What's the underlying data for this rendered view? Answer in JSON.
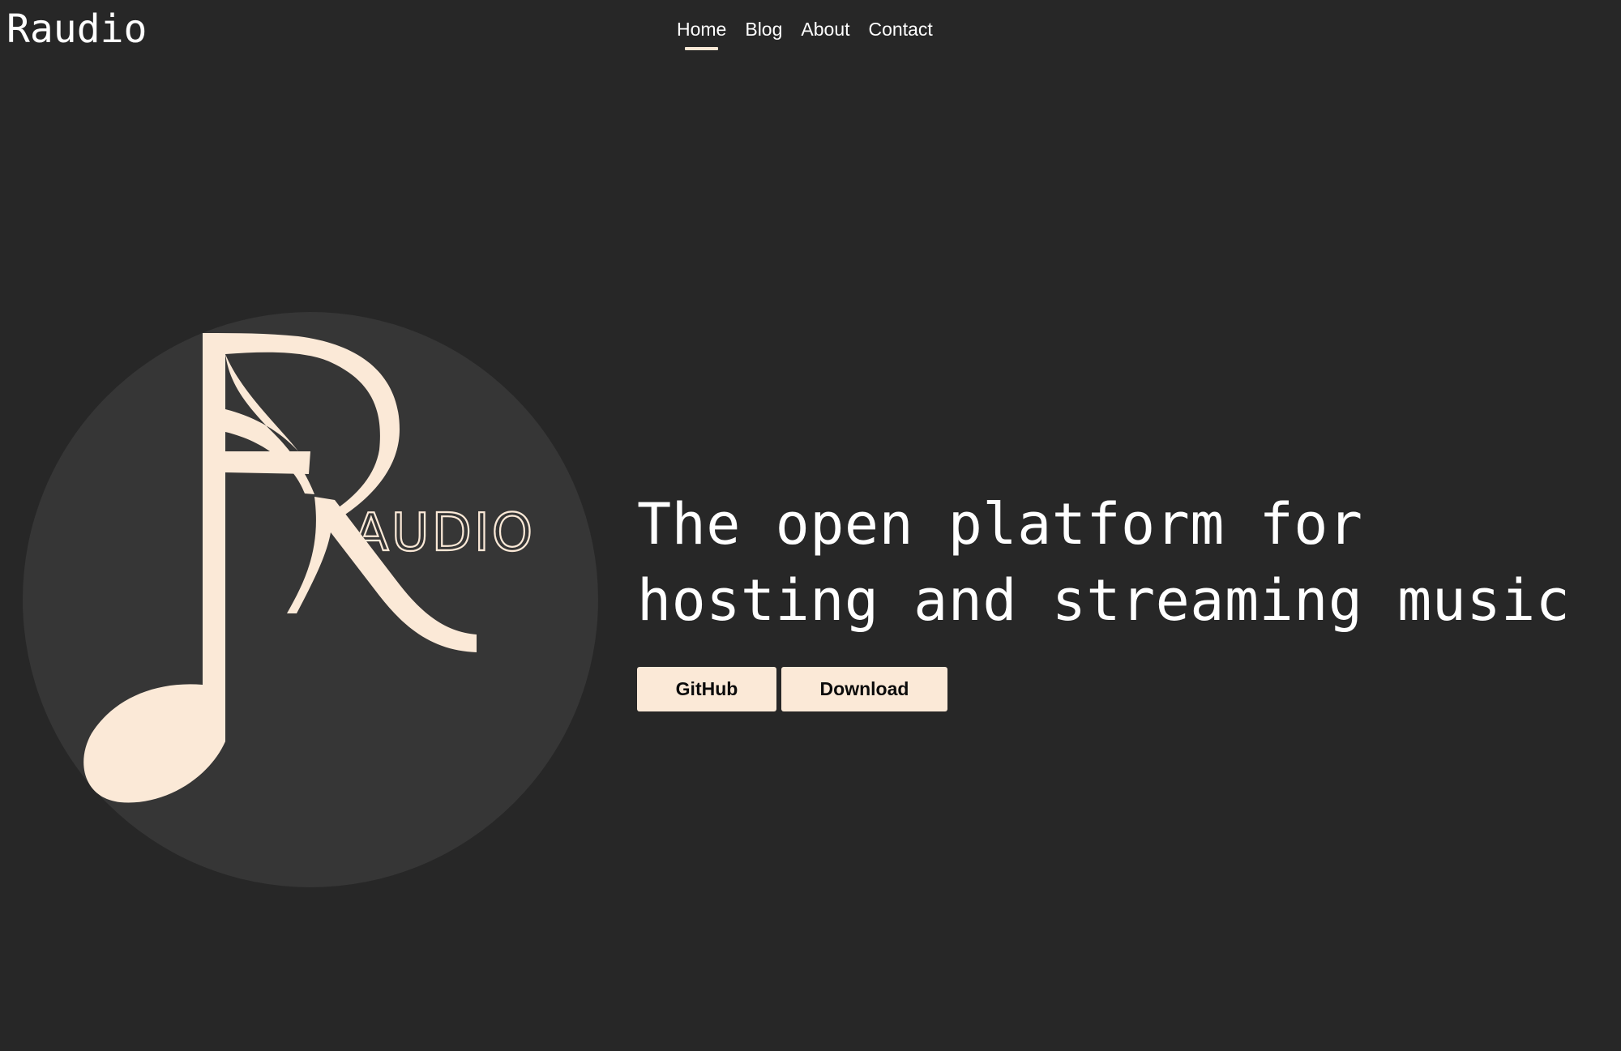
{
  "header": {
    "brand": "Raudio",
    "nav": [
      {
        "label": "Home",
        "active": true
      },
      {
        "label": "Blog",
        "active": false
      },
      {
        "label": "About",
        "active": false
      },
      {
        "label": "Contact",
        "active": false
      }
    ]
  },
  "hero": {
    "logo": {
      "icon": "music-note-r-logo-icon",
      "wordmark": "AUDIO"
    },
    "headline_lines": [
      "The open platform for",
      "hosting and streaming music"
    ],
    "buttons": [
      {
        "label": "GitHub"
      },
      {
        "label": "Download"
      }
    ]
  },
  "colors": {
    "background": "#272727",
    "circle": "#363636",
    "accent": "#fbe9d7",
    "text": "#ffffff"
  }
}
